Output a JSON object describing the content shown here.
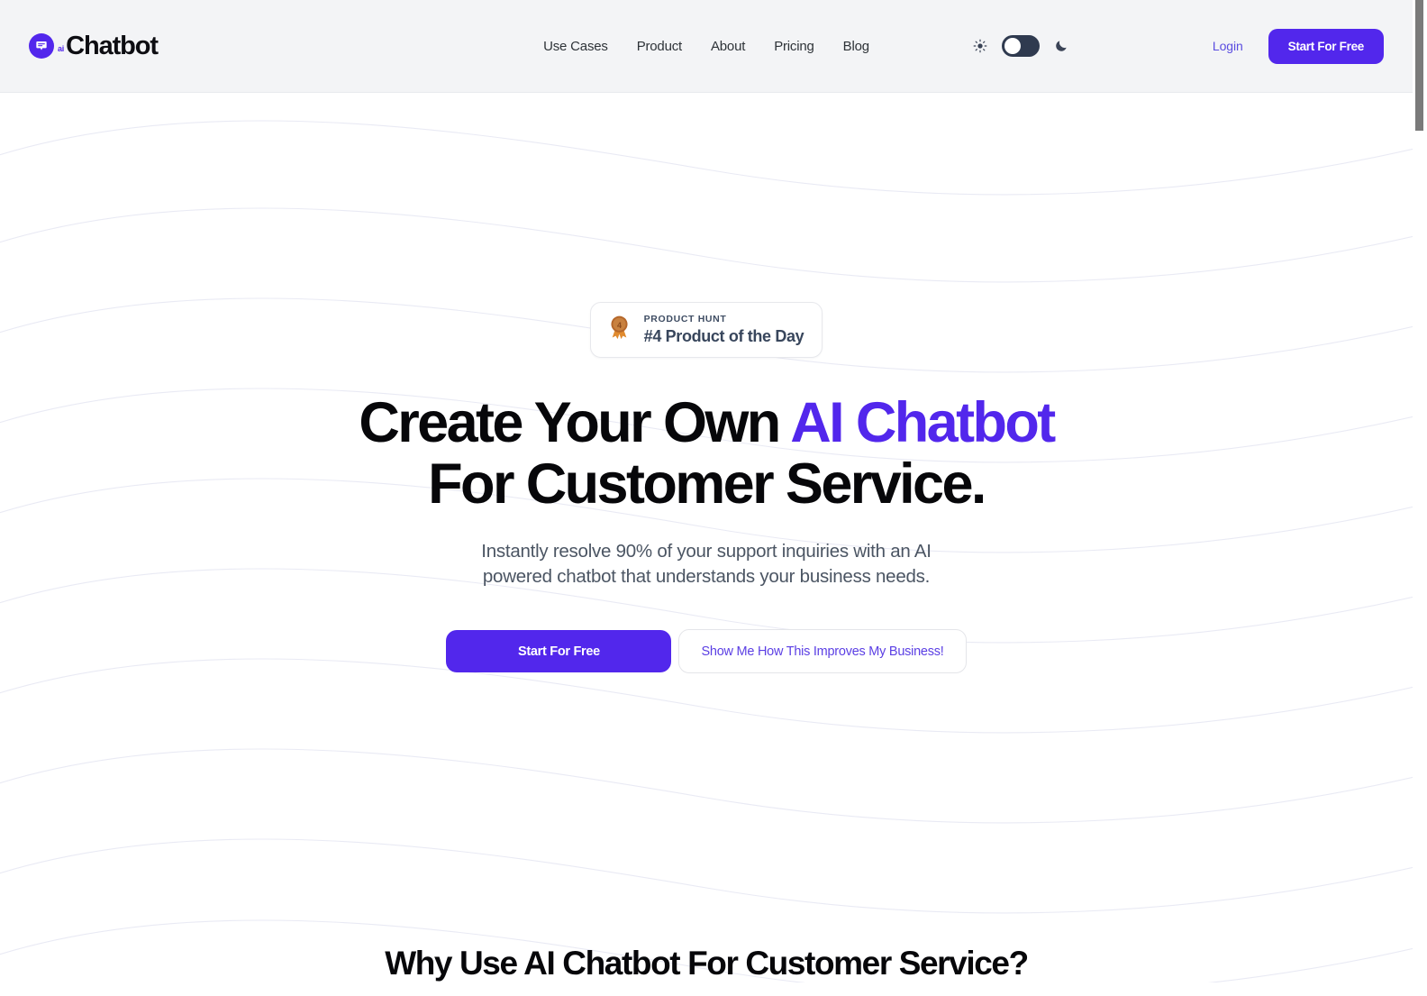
{
  "header": {
    "brand": {
      "mark_icon": "chat-bubble-icon",
      "superscript": "ai",
      "name": "Chatbot"
    },
    "nav": [
      {
        "label": "Use Cases"
      },
      {
        "label": "Product"
      },
      {
        "label": "About"
      },
      {
        "label": "Pricing"
      },
      {
        "label": "Blog"
      }
    ],
    "theme": {
      "light_icon": "sun-icon",
      "dark_icon": "moon-icon",
      "toggle_state": "light",
      "toggle_track_color": "#2f3a4f",
      "toggle_knob_color": "#ffffff"
    },
    "login_label": "Login",
    "cta_label": "Start For Free",
    "background_color": "#f3f4f6"
  },
  "hero": {
    "badge": {
      "icon": "medal-icon",
      "medal_rank": "4",
      "kicker": "PRODUCT HUNT",
      "title": "#4 Product of the Day"
    },
    "title_line1_plain": "Create Your Own ",
    "title_line1_accent": "AI Chatbot",
    "title_line2": "For Customer Service.",
    "subtitle": "Instantly resolve 90% of your support inquiries with an AI powered chatbot that understands your business needs.",
    "primary_cta": "Start For Free",
    "secondary_cta": "Show Me How This Improves My Business!"
  },
  "next_section": {
    "title": "Why Use AI Chatbot For Customer Service?"
  },
  "colors": {
    "brand_purple": "#5227ec",
    "link_purple": "#5b4de0",
    "body_text": "#4b5563",
    "heading": "#07070a",
    "header_bg": "#f3f4f6",
    "badge_text": "#38465c"
  },
  "scrollbar": {
    "thumb_color": "#7a7a7a",
    "position": "top"
  }
}
